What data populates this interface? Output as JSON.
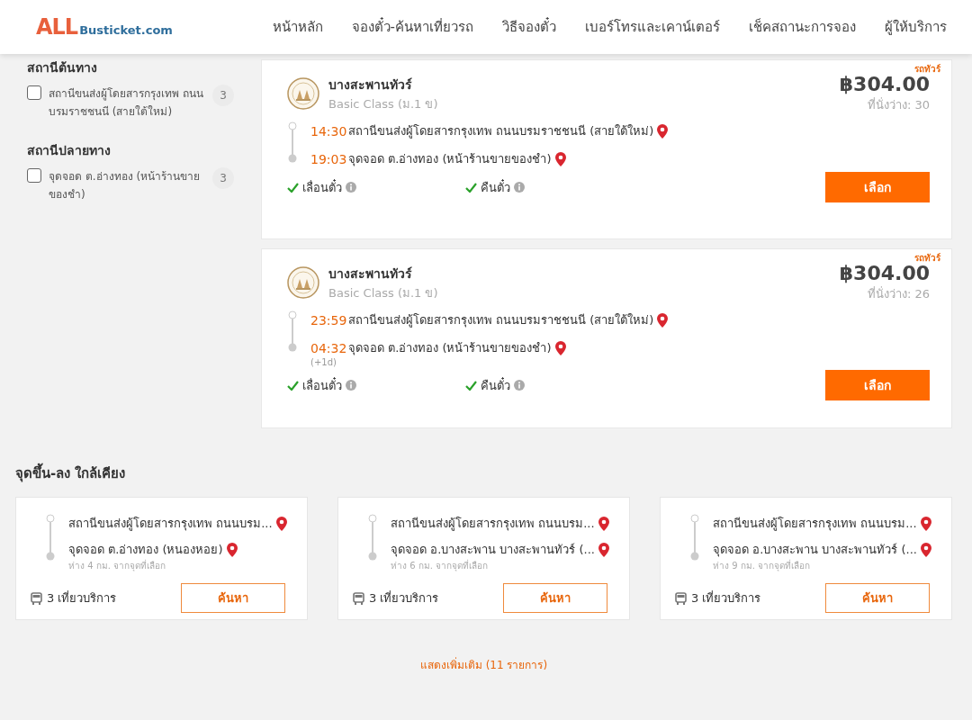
{
  "header": {
    "logo": {
      "primary": "ALL",
      "secondary": "Busticket.com"
    },
    "nav": [
      {
        "label": "หน้าหลัก"
      },
      {
        "label": "จองตั๋ว-ค้นหาเที่ยวรถ"
      },
      {
        "label": "วิธีจองตั๋ว"
      },
      {
        "label": "เบอร์โทรและเคาน์เตอร์"
      },
      {
        "label": "เช็คสถานะการจอง"
      },
      {
        "label": "ผู้ให้บริการ"
      }
    ]
  },
  "filters": [
    {
      "title": "สถานีต้นทาง",
      "options": [
        {
          "label": "สถานีขนส่งผู้โดยสารกรุงเทพ ถนนบรมราชชนนี (สายใต้ใหม่)",
          "count": "3",
          "checked": false
        }
      ]
    },
    {
      "title": "สถานีปลายทาง",
      "options": [
        {
          "label": "จุดจอด ต.อ่างทอง (หน้าร้านขายของชำ)",
          "count": "3",
          "checked": false
        }
      ]
    }
  ],
  "trips": [
    {
      "tag": "รถทัวร์",
      "operator": "บางสะพานทัวร์",
      "class": "Basic Class (ม.1 ข)",
      "price": "฿304.00",
      "seats": "ที่นั่งว่าง: 30",
      "depart_time": "14:30",
      "depart_station": "สถานีขนส่งผู้โดยสารกรุงเทพ ถนนบรมราชชนนี (สายใต้ใหม่)",
      "arrive_time": "19:03",
      "arrive_station": "จุดจอด ต.อ่างทอง (หน้าร้านขายของชำ)",
      "features": [
        {
          "label": "เลื่อนตั๋ว",
          "available": true
        },
        {
          "label": "คืนตั๋ว",
          "available": true
        }
      ],
      "button": "เลือก"
    },
    {
      "tag": "รถทัวร์",
      "operator": "บางสะพานทัวร์",
      "class": "Basic Class (ม.1 ข)",
      "price": "฿304.00",
      "seats": "ที่นั่งว่าง: 26",
      "depart_time": "23:59",
      "depart_station": "สถานีขนส่งผู้โดยสารกรุงเทพ ถนนบรมราชชนนี (สายใต้ใหม่)",
      "arrive_time": "04:32",
      "arrive_note": "(+1d)",
      "arrive_station": "จุดจอด ต.อ่างทอง (หน้าร้านขายของชำ)",
      "features": [
        {
          "label": "เลื่อนตั๋ว",
          "available": true
        },
        {
          "label": "คืนตั๋ว",
          "available": true
        }
      ],
      "button": "เลือก"
    }
  ],
  "nearby": {
    "title": "จุดขึ้น-ลง ใกล้เคียง",
    "items": [
      {
        "from": "สถานีขนส่งผู้โดยสารกรุงเทพ ถนนบรม...",
        "to": "จุดจอด ต.อ่างทอง (หนองหอย)",
        "distance": "ห่าง 4 กม. จากจุดที่เลือก",
        "trips": "3 เที่ยวบริการ",
        "button": "ค้นหา"
      },
      {
        "from": "สถานีขนส่งผู้โดยสารกรุงเทพ ถนนบรม...",
        "to": "จุดจอด อ.บางสะพาน บางสะพานทัวร์ (...",
        "distance": "ห่าง 6 กม. จากจุดที่เลือก",
        "trips": "3 เที่ยวบริการ",
        "button": "ค้นหา"
      },
      {
        "from": "สถานีขนส่งผู้โดยสารกรุงเทพ ถนนบรม...",
        "to": "จุดจอด อ.บางสะพาน บางสะพานทัวร์ (...",
        "distance": "ห่าง 9 กม. จากจุดที่เลือก",
        "trips": "3 เที่ยวบริการ",
        "button": "ค้นหา"
      }
    ],
    "more": "แสดงเพิ่มเติม (11 รายการ)"
  }
}
